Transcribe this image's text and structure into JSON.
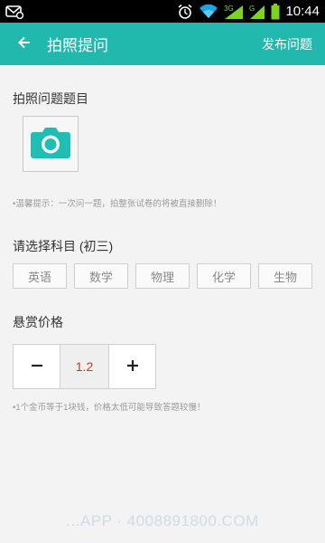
{
  "status_bar": {
    "time": "10:44",
    "icons": [
      "notification-icon",
      "alarm-icon",
      "wifi-icon",
      "signal-3g-icon",
      "signal-icon",
      "battery-icon"
    ],
    "network_label_1": "3G",
    "network_label_2": "G"
  },
  "app_bar": {
    "title": "拍照提问",
    "action": "发布问题",
    "back_icon": "arrow-left-icon",
    "color": "#21b9ae"
  },
  "photo_section": {
    "title": "拍照问题题目",
    "camera_icon": "camera-icon",
    "tip": "•温馨提示：一次问一题，拍整张试卷的将被直接删除！"
  },
  "subject_section": {
    "title": "请选择科目 (初三)",
    "subjects": [
      "英语",
      "数学",
      "物理",
      "化学",
      "生物"
    ]
  },
  "price_section": {
    "title": "悬赏价格",
    "decrement": "−",
    "increment": "+",
    "value": "1.2",
    "tip": "•1个金币等于1块钱，价格太低可能导致答题较慢！"
  },
  "watermark": "...APP · 4008891800.COM"
}
